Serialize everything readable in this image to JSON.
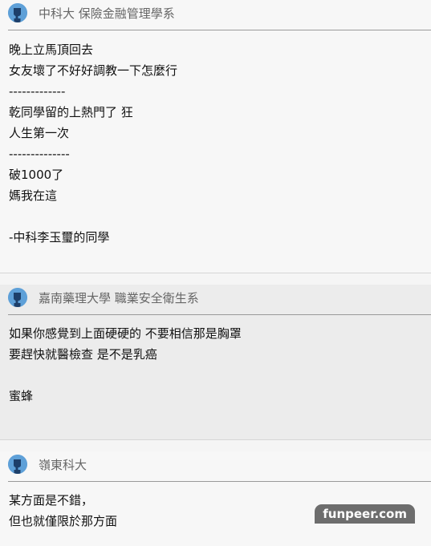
{
  "comments": [
    {
      "school": "中科大 保險金融管理學系",
      "lines": [
        "晚上立馬頂回去",
        "女友壞了不好好調教一下怎麼行",
        "-------------",
        "乾同學留的上熱門了 狂",
        "人生第一次",
        "--------------",
        "破1000了",
        "媽我在這",
        "",
        "-中科李玉璽的同學"
      ]
    },
    {
      "school": "嘉南藥理大學 職業安全衛生系",
      "lines": [
        "如果你感覺到上面硬硬的 不要相信那是胸罩",
        "要趕快就醫檢查 是不是乳癌",
        "",
        "蜜蜂"
      ]
    },
    {
      "school": "嶺東科大",
      "lines": [
        "某方面是不錯，",
        "但也就僅限於那方面"
      ]
    }
  ],
  "avatar_icon": "anonymous-user-icon",
  "avatar_color": "#5ea0d8",
  "watermark": "funpeer.com"
}
